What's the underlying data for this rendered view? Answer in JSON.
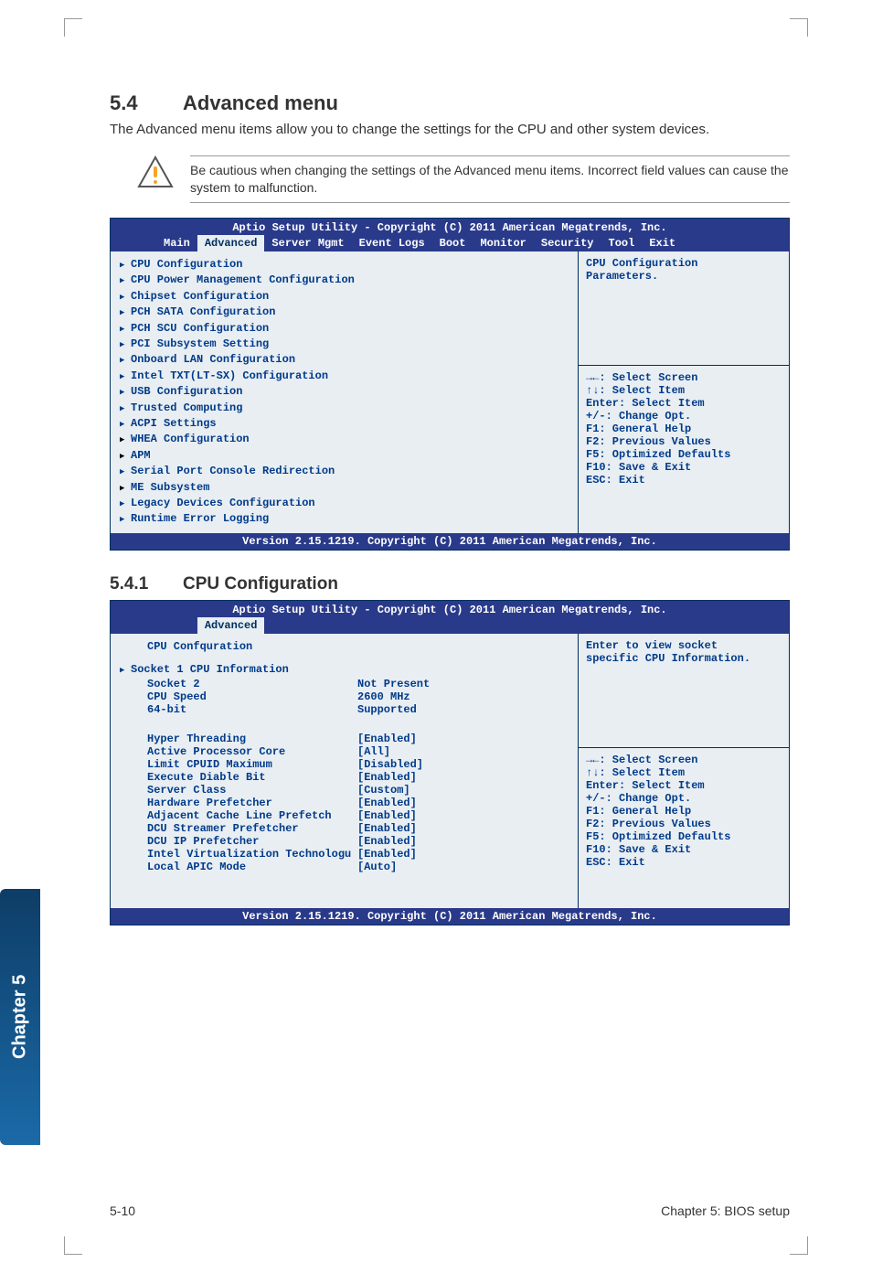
{
  "section": {
    "num": "5.4",
    "title": "Advanced menu"
  },
  "intro": "The Advanced menu items allow you to change the settings for the CPU and other system devices.",
  "note": "Be cautious when changing the settings of the Advanced menu items. Incorrect field values can cause the system to malfunction.",
  "bios1": {
    "header": "Aptio Setup Utility - Copyright (C) 2011 American Megatrends, Inc.",
    "tabs": [
      "Main",
      "Advanced",
      "Server Mgmt",
      "Event Logs",
      "Boot",
      "Monitor",
      "Security",
      "Tool",
      "Exit"
    ],
    "active_tab": "Advanced",
    "items": [
      "CPU Configuration",
      "CPU Power Management Configuration",
      "Chipset Configuration",
      "PCH SATA Configuration",
      "PCH SCU Configuration",
      "PCI Subsystem Setting",
      "Onboard LAN Configuration",
      "Intel TXT(LT-SX) Configuration",
      "USB Configuration",
      "Trusted Computing",
      "ACPI Settings",
      "WHEA Configuration",
      "APM",
      "Serial Port Console Redirection",
      "ME Subsystem",
      "Legacy Devices Configuration",
      "Runtime Error Logging"
    ],
    "help_top": [
      "CPU Configuration",
      "Parameters."
    ],
    "help_keys": [
      "→←: Select Screen",
      "↑↓: Select Item",
      "Enter: Select Item",
      "+/-: Change Opt.",
      "F1: General Help",
      "F2: Previous Values",
      "F5: Optimized Defaults",
      "F10: Save & Exit",
      "ESC: Exit"
    ],
    "footer": "Version 2.15.1219. Copyright (C) 2011 American Megatrends, Inc."
  },
  "subsection": {
    "num": "5.4.1",
    "title": "CPU Configuration"
  },
  "bios2": {
    "header": "Aptio Setup Utility - Copyright (C) 2011 American Megatrends, Inc.",
    "tab": "Advanced",
    "title_row": "CPU Confquration",
    "sub_item": "Socket 1 CPU Information",
    "static": [
      {
        "k": "Socket 2",
        "v": "Not Present"
      },
      {
        "k": "CPU Speed",
        "v": "2600 MHz"
      },
      {
        "k": "64-bit",
        "v": "Supported"
      }
    ],
    "options": [
      {
        "k": "Hyper Threading",
        "v": "[Enabled]"
      },
      {
        "k": "Active Processor Core",
        "v": "[All]"
      },
      {
        "k": "Limit CPUID Maximum",
        "v": "[Disabled]"
      },
      {
        "k": "Execute Diable Bit",
        "v": "[Enabled]"
      },
      {
        "k": "Server Class",
        "v": "[Custom]"
      },
      {
        "k": "Hardware Prefetcher",
        "v": "[Enabled]"
      },
      {
        "k": "Adjacent Cache Line Prefetch",
        "v": "[Enabled]"
      },
      {
        "k": "DCU Streamer Prefetcher",
        "v": "[Enabled]"
      },
      {
        "k": "DCU IP Prefetcher",
        "v": "[Enabled]"
      },
      {
        "k": "Intel Virtualization Technologu",
        "v": "[Enabled]"
      },
      {
        "k": "Local APIC Mode",
        "v": "[Auto]"
      }
    ],
    "help_top": [
      "Enter to view socket",
      "specific CPU Information."
    ],
    "help_keys": [
      "→←: Select Screen",
      "↑↓: Select Item",
      "Enter: Select Item",
      "+/-: Change Opt.",
      "F1: General Help",
      "F2: Previous Values",
      "F5: Optimized Defaults",
      "F10: Save & Exit",
      "ESC: Exit"
    ],
    "footer": "Version 2.15.1219. Copyright (C) 2011 American Megatrends, Inc."
  },
  "side_tab": "Chapter 5",
  "page_num": "5-10",
  "page_title": "Chapter 5: BIOS setup"
}
